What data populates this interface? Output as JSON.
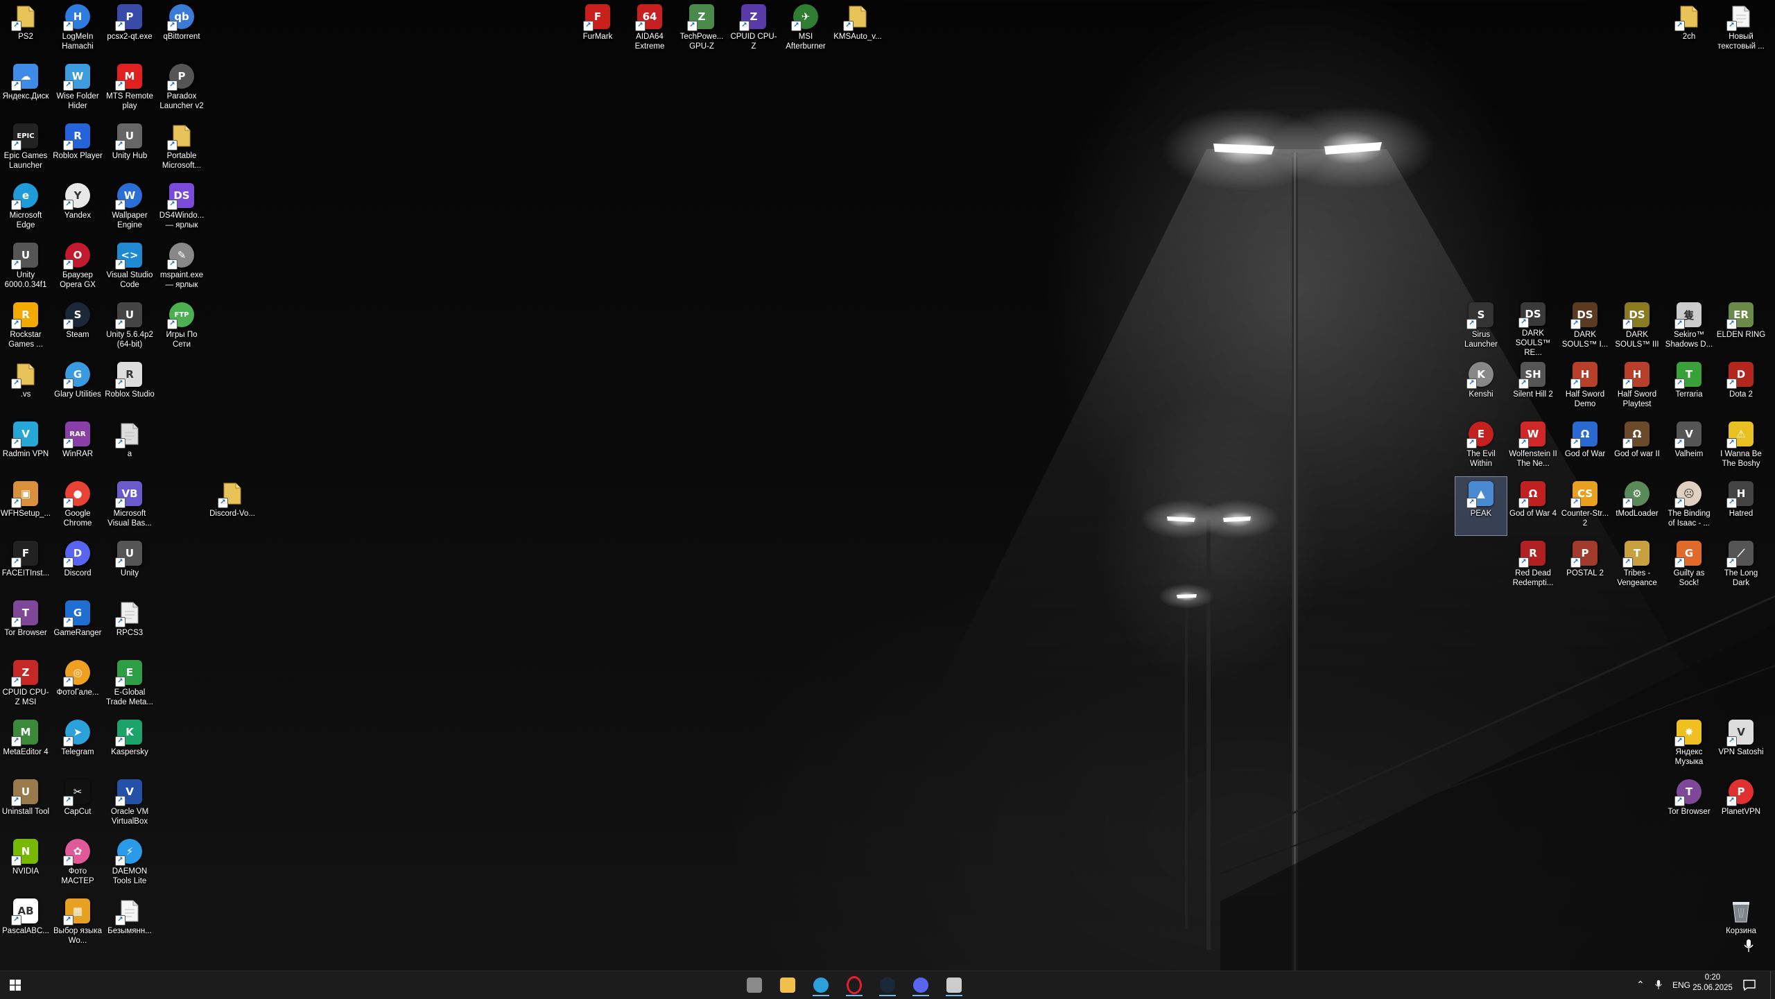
{
  "desktop": {
    "icons_left": [
      {
        "label": "PS2",
        "icon": "folder-icon",
        "color": "#e8c35a",
        "glyph": "",
        "col": 0,
        "row": 0
      },
      {
        "label": "LogMeIn Hamachi",
        "icon": "hamachi-icon",
        "color": "#2d7de0",
        "glyph": "H",
        "round": true,
        "col": 1,
        "row": 0
      },
      {
        "label": "pcsx2-qt.exe",
        "icon": "pcsx2-icon",
        "color": "#3a4aa8",
        "glyph": "P",
        "col": 2,
        "row": 0
      },
      {
        "label": "qBittorrent",
        "icon": "qbittorrent-icon",
        "color": "#3b7bd8",
        "glyph": "qb",
        "round": true,
        "col": 3,
        "row": 0
      },
      {
        "label": "Яндекс.Диск",
        "icon": "yandex-disk-icon",
        "color": "#3f8be8",
        "glyph": "☁",
        "col": 0,
        "row": 1
      },
      {
        "label": "Wise Folder Hider",
        "icon": "wise-folder-icon",
        "color": "#3d9be0",
        "glyph": "W",
        "col": 1,
        "row": 1
      },
      {
        "label": "MTS Remote play",
        "icon": "mts-icon",
        "color": "#e32020",
        "glyph": "M",
        "col": 2,
        "row": 1
      },
      {
        "label": "Paradox Launcher v2",
        "icon": "paradox-icon",
        "color": "#555555",
        "glyph": "P",
        "round": true,
        "col": 3,
        "row": 1
      },
      {
        "label": "Epic Games Launcher",
        "icon": "epic-icon",
        "color": "#222222",
        "glyph": "EPIC",
        "col": 0,
        "row": 2
      },
      {
        "label": "Roblox Player",
        "icon": "roblox-icon",
        "color": "#2563d8",
        "glyph": "R",
        "col": 1,
        "row": 2
      },
      {
        "label": "Unity Hub",
        "icon": "unity-hub-icon",
        "color": "#666666",
        "glyph": "U",
        "col": 2,
        "row": 2
      },
      {
        "label": "Portable Microsoft...",
        "icon": "folder-icon",
        "color": "#e8c35a",
        "glyph": "",
        "col": 3,
        "row": 2
      },
      {
        "label": "Microsoft Edge",
        "icon": "edge-icon",
        "color": "#1e9bd8",
        "glyph": "e",
        "round": true,
        "col": 0,
        "row": 3
      },
      {
        "label": "Yandex",
        "icon": "yandex-icon",
        "color": "#e8e8e8",
        "glyph": "Y",
        "round": true,
        "col": 1,
        "row": 3
      },
      {
        "label": "Wallpaper Engine",
        "icon": "wallpaper-engine-icon",
        "color": "#2a6fd8",
        "glyph": "W",
        "round": true,
        "col": 2,
        "row": 3
      },
      {
        "label": "DS4Windo... — ярлык",
        "icon": "ds4windows-icon",
        "color": "#7a4ad8",
        "glyph": "DS",
        "col": 3,
        "row": 3
      },
      {
        "label": "Unity 6000.0.34f1",
        "icon": "unity-icon",
        "color": "#555555",
        "glyph": "U",
        "col": 0,
        "row": 4
      },
      {
        "label": "Браузер Opera GX",
        "icon": "opera-gx-icon",
        "color": "#c21b2f",
        "glyph": "O",
        "round": true,
        "col": 1,
        "row": 4
      },
      {
        "label": "Visual Studio Code",
        "icon": "vscode-icon",
        "color": "#1f8ad2",
        "glyph": "<>",
        "col": 2,
        "row": 4
      },
      {
        "label": "mspaint.exe — ярлык",
        "icon": "mspaint-icon",
        "color": "#888888",
        "glyph": "✎",
        "round": true,
        "col": 3,
        "row": 4
      },
      {
        "label": "Rockstar Games ...",
        "icon": "rockstar-icon",
        "color": "#f2a900",
        "glyph": "R",
        "col": 0,
        "row": 5
      },
      {
        "label": "Steam",
        "icon": "steam-icon",
        "color": "#1b2838",
        "glyph": "S",
        "round": true,
        "col": 1,
        "row": 5
      },
      {
        "label": "Unity 5.6.4p2 (64-bit)",
        "icon": "unity-icon",
        "color": "#444444",
        "glyph": "U",
        "col": 2,
        "row": 5
      },
      {
        "label": "Игры По Сети",
        "icon": "ftp-icon",
        "color": "#4caf50",
        "glyph": "FTP",
        "round": true,
        "col": 3,
        "row": 5
      },
      {
        "label": ".vs",
        "icon": "folder-icon",
        "color": "#e8c35a",
        "glyph": "",
        "col": 0,
        "row": 6
      },
      {
        "label": "Glary Utilities",
        "icon": "glary-icon",
        "color": "#3a9ae0",
        "glyph": "G",
        "round": true,
        "col": 1,
        "row": 6
      },
      {
        "label": "Roblox Studio",
        "icon": "roblox-studio-icon",
        "color": "#dddddd",
        "glyph": "R",
        "col": 2,
        "row": 6
      },
      {
        "label": "Radmin VPN",
        "icon": "radmin-vpn-icon",
        "color": "#27a7d8",
        "glyph": "V",
        "col": 0,
        "row": 7
      },
      {
        "label": "WinRAR",
        "icon": "winrar-icon",
        "color": "#8a3fa8",
        "glyph": "RAR",
        "col": 1,
        "row": 7
      },
      {
        "label": "a",
        "icon": "file-icon",
        "color": "#dddddd",
        "glyph": "",
        "col": 2,
        "row": 7
      },
      {
        "label": "WFHSetup_...",
        "icon": "package-icon",
        "color": "#d8913a",
        "glyph": "▣",
        "col": 0,
        "row": 8
      },
      {
        "label": "Google Chrome",
        "icon": "chrome-icon",
        "color": "#e94235",
        "glyph": "●",
        "round": true,
        "col": 1,
        "row": 8
      },
      {
        "label": "Microsoft Visual Bas...",
        "icon": "visual-basic-icon",
        "color": "#6a5acd",
        "glyph": "VB",
        "col": 2,
        "row": 8
      },
      {
        "label": "FACEITInst...",
        "icon": "faceit-icon",
        "color": "#222222",
        "glyph": "F",
        "col": 0,
        "row": 9
      },
      {
        "label": "Discord",
        "icon": "discord-icon",
        "color": "#5865f2",
        "glyph": "D",
        "round": true,
        "col": 1,
        "row": 9
      },
      {
        "label": "Unity",
        "icon": "unity-icon",
        "color": "#555555",
        "glyph": "U",
        "col": 2,
        "row": 9
      },
      {
        "label": "Tor Browser",
        "icon": "tor-browser-icon",
        "color": "#7e4798",
        "glyph": "T",
        "col": 0,
        "row": 10
      },
      {
        "label": "GameRanger",
        "icon": "gameranger-icon",
        "color": "#1f6fd0",
        "glyph": "G",
        "col": 1,
        "row": 10
      },
      {
        "label": "RPCS3",
        "icon": "file-icon",
        "color": "#eeeeee",
        "glyph": "",
        "col": 2,
        "row": 10
      },
      {
        "label": "CPUID CPU-Z MSI",
        "icon": "cpuz-msi-icon",
        "color": "#c62828",
        "glyph": "Z",
        "col": 0,
        "row": 11
      },
      {
        "label": "ФотоГале...",
        "icon": "photo-gallery-icon",
        "color": "#f0a020",
        "glyph": "◎",
        "round": true,
        "col": 1,
        "row": 11
      },
      {
        "label": "E-Global Trade Meta...",
        "icon": "metatrader-icon",
        "color": "#2e9e44",
        "glyph": "E",
        "col": 2,
        "row": 11
      },
      {
        "label": "MetaEditor 4",
        "icon": "metaeditor-icon",
        "color": "#3a8a3a",
        "glyph": "M",
        "col": 0,
        "row": 12
      },
      {
        "label": "Telegram",
        "icon": "telegram-icon",
        "color": "#2aa1da",
        "glyph": "➤",
        "round": true,
        "col": 1,
        "row": 12
      },
      {
        "label": "Kaspersky",
        "icon": "kaspersky-icon",
        "color": "#1ba36a",
        "glyph": "K",
        "col": 2,
        "row": 12
      },
      {
        "label": "Uninstall Tool",
        "icon": "uninstall-tool-icon",
        "color": "#9a7a4a",
        "glyph": "U",
        "col": 0,
        "row": 13
      },
      {
        "label": "CapCut",
        "icon": "capcut-icon",
        "color": "#111111",
        "glyph": "✂",
        "col": 1,
        "row": 13
      },
      {
        "label": "Oracle VM VirtualBox",
        "icon": "virtualbox-icon",
        "color": "#2450a8",
        "glyph": "V",
        "col": 2,
        "row": 13
      },
      {
        "label": "NVIDIA",
        "icon": "nvidia-icon",
        "color": "#76b900",
        "glyph": "N",
        "col": 0,
        "row": 14
      },
      {
        "label": "Фото МАСТЕР",
        "icon": "photo-master-icon",
        "color": "#e05a9a",
        "glyph": "✿",
        "round": true,
        "col": 1,
        "row": 14
      },
      {
        "label": "DAEMON Tools Lite",
        "icon": "daemon-tools-icon",
        "color": "#2a9be8",
        "glyph": "⚡",
        "round": true,
        "col": 2,
        "row": 14
      },
      {
        "label": "PascalABC...",
        "icon": "pascalabc-icon",
        "color": "#ffffff",
        "glyph": "AB",
        "col": 0,
        "row": 15
      },
      {
        "label": "Выбор языка Wo...",
        "icon": "language-icon",
        "color": "#e8a020",
        "glyph": "▦",
        "col": 1,
        "row": 15
      },
      {
        "label": "Безымянн...",
        "icon": "file-icon",
        "color": "#f5f5f5",
        "glyph": "",
        "col": 2,
        "row": 15
      }
    ],
    "icon_discord_vo": {
      "label": "Discord-Vo...",
      "icon": "folder-icon",
      "color": "#e8c35a"
    },
    "icons_top": [
      {
        "label": "FurMark",
        "icon": "furmark-icon",
        "color": "#c8201a",
        "glyph": "F"
      },
      {
        "label": "AIDA64 Extreme",
        "icon": "aida64-icon",
        "color": "#c62020",
        "glyph": "64"
      },
      {
        "label": "TechPowe... GPU-Z",
        "icon": "gpuz-icon",
        "color": "#4a8a4a",
        "glyph": "Z"
      },
      {
        "label": "CPUID CPU-Z",
        "icon": "cpuz-icon",
        "color": "#5a3aa8",
        "glyph": "Z"
      },
      {
        "label": "MSI Afterburner",
        "icon": "afterburner-icon",
        "color": "#2e7d32",
        "glyph": "✈",
        "round": true
      },
      {
        "label": "KMSAuto_v...",
        "icon": "folder-icon",
        "color": "#e8c35a",
        "glyph": ""
      }
    ],
    "icons_top_right": [
      {
        "label": "2ch",
        "icon": "folder-icon",
        "color": "#e8c35a",
        "glyph": ""
      },
      {
        "label": "Новый текстовый ...",
        "icon": "text-file-icon",
        "color": "#f5f5f5",
        "glyph": ""
      }
    ],
    "icons_games": [
      {
        "label": "Sirus Launcher",
        "icon": "sirus-icon",
        "color": "#333333",
        "glyph": "S",
        "col": 0,
        "row": 0
      },
      {
        "label": "DARK SOULS™ RE...",
        "icon": "dark-souls-icon",
        "color": "#3a3a3a",
        "glyph": "DS",
        "col": 1,
        "row": 0
      },
      {
        "label": "DARK SOULS™ I...",
        "icon": "dark-souls-icon",
        "color": "#5a3a20",
        "glyph": "DS",
        "col": 2,
        "row": 0
      },
      {
        "label": "DARK SOULS™ III",
        "icon": "dark-souls-icon",
        "color": "#8a7a20",
        "glyph": "DS",
        "col": 3,
        "row": 0
      },
      {
        "label": "Sekiro™ Shadows D...",
        "icon": "sekiro-icon",
        "color": "#cccccc",
        "glyph": "隻",
        "col": 4,
        "row": 0
      },
      {
        "label": "ELDEN RING",
        "icon": "elden-ring-icon",
        "color": "#6a8a4a",
        "glyph": "ER",
        "col": 5,
        "row": 0
      },
      {
        "label": "Kenshi",
        "icon": "kenshi-icon",
        "color": "#888888",
        "glyph": "K",
        "round": true,
        "col": 0,
        "row": 1
      },
      {
        "label": "Silent Hill 2",
        "icon": "silent-hill-icon",
        "color": "#555555",
        "glyph": "SH",
        "col": 1,
        "row": 1
      },
      {
        "label": "Half Sword Demo",
        "icon": "half-sword-icon",
        "color": "#b8402a",
        "glyph": "H",
        "col": 2,
        "row": 1
      },
      {
        "label": "Half Sword Playtest",
        "icon": "half-sword-icon",
        "color": "#b8402a",
        "glyph": "H",
        "col": 3,
        "row": 1
      },
      {
        "label": "Terraria",
        "icon": "terraria-icon",
        "color": "#3aa03a",
        "glyph": "T",
        "col": 4,
        "row": 1
      },
      {
        "label": "Dota 2",
        "icon": "dota-icon",
        "color": "#b3261e",
        "glyph": "D",
        "col": 5,
        "row": 1
      },
      {
        "label": "The Evil Within",
        "icon": "evil-within-icon",
        "color": "#c42020",
        "glyph": "E",
        "round": true,
        "col": 0,
        "row": 2
      },
      {
        "label": "Wolfenstein II The Ne...",
        "icon": "wolfenstein-icon",
        "color": "#d02828",
        "glyph": "W",
        "col": 1,
        "row": 2
      },
      {
        "label": "God of War",
        "icon": "god-of-war-icon",
        "color": "#2a6ad0",
        "glyph": "Ω",
        "col": 2,
        "row": 2
      },
      {
        "label": "God of war II",
        "icon": "god-of-war-icon",
        "color": "#6a4a2a",
        "glyph": "Ω",
        "col": 3,
        "row": 2
      },
      {
        "label": "Valheim",
        "icon": "valheim-icon",
        "color": "#555555",
        "glyph": "V",
        "col": 4,
        "row": 2
      },
      {
        "label": "I Wanna Be The Boshy",
        "icon": "boshy-icon",
        "color": "#e8c020",
        "glyph": "⚠",
        "col": 5,
        "row": 2
      },
      {
        "label": "PEAK",
        "icon": "peak-icon",
        "color": "#4a8ad0",
        "glyph": "▲",
        "col": 0,
        "row": 3,
        "selected": true
      },
      {
        "label": "God of War 4",
        "icon": "god-of-war-icon",
        "color": "#c02020",
        "glyph": "Ω",
        "col": 1,
        "row": 3
      },
      {
        "label": "Counter-Str... 2",
        "icon": "counter-strike-icon",
        "color": "#e8a020",
        "glyph": "CS",
        "col": 2,
        "row": 3
      },
      {
        "label": "tModLoader",
        "icon": "tmodloader-icon",
        "color": "#5a8a5a",
        "glyph": "⚙",
        "round": true,
        "col": 3,
        "row": 3
      },
      {
        "label": "The Binding of Isaac - ...",
        "icon": "isaac-icon",
        "color": "#e0d0c0",
        "glyph": "☹",
        "round": true,
        "col": 4,
        "row": 3
      },
      {
        "label": "Hatred",
        "icon": "hatred-icon",
        "color": "#444444",
        "glyph": "H",
        "col": 5,
        "row": 3
      },
      {
        "label": "Red Dead Redempti...",
        "icon": "red-dead-icon",
        "color": "#b02020",
        "glyph": "R",
        "col": 1,
        "row": 4
      },
      {
        "label": "POSTAL 2",
        "icon": "postal-icon",
        "color": "#a03a2a",
        "glyph": "P",
        "col": 2,
        "row": 4
      },
      {
        "label": "Tribes - Vengeance",
        "icon": "tribes-icon",
        "color": "#c8a040",
        "glyph": "T",
        "col": 3,
        "row": 4
      },
      {
        "label": "Guilty as Sock!",
        "icon": "guilty-sock-icon",
        "color": "#e06a2a",
        "glyph": "G",
        "col": 4,
        "row": 4
      },
      {
        "label": "The Long Dark",
        "icon": "long-dark-icon",
        "color": "#555555",
        "glyph": "⟋",
        "col": 5,
        "row": 4
      }
    ],
    "icons_bottom_right": [
      {
        "label": "Яндекс Музыка",
        "icon": "yandex-music-icon",
        "color": "#f0c020",
        "glyph": "✸",
        "col": 0,
        "row": 0
      },
      {
        "label": "VPN Satoshi",
        "icon": "vpn-satoshi-icon",
        "color": "#dddddd",
        "glyph": "V",
        "col": 1,
        "row": 0
      },
      {
        "label": "Tor Browser",
        "icon": "tor-browser-icon",
        "color": "#7e4798",
        "glyph": "T",
        "round": true,
        "col": 0,
        "row": 1
      },
      {
        "label": "PlanetVPN",
        "icon": "planet-vpn-icon",
        "color": "#e03030",
        "glyph": "P",
        "round": true,
        "col": 1,
        "row": 1
      }
    ],
    "recycle_bin": {
      "label": "Корзина",
      "icon": "recycle-bin-icon"
    }
  },
  "taskbar": {
    "apps": [
      {
        "name": "task-view",
        "icon": "task-view-icon",
        "color": "#8a8a8a"
      },
      {
        "name": "file-explorer",
        "icon": "file-explorer-icon",
        "color": "#f2c04a"
      },
      {
        "name": "telegram",
        "icon": "telegram-icon",
        "color": "#2aa1da",
        "active": true
      },
      {
        "name": "opera-gx",
        "icon": "opera-gx-icon",
        "color": "#e02030",
        "active": true
      },
      {
        "name": "steam",
        "icon": "steam-icon",
        "color": "#1b2838",
        "active": true
      },
      {
        "name": "discord",
        "icon": "discord-icon",
        "color": "#5865f2",
        "active": true
      },
      {
        "name": "terminal",
        "icon": "terminal-icon",
        "color": "#cccccc",
        "active": true
      }
    ],
    "tray": {
      "language": "ENG",
      "time": "0:20",
      "date": "25.06.2025"
    }
  }
}
